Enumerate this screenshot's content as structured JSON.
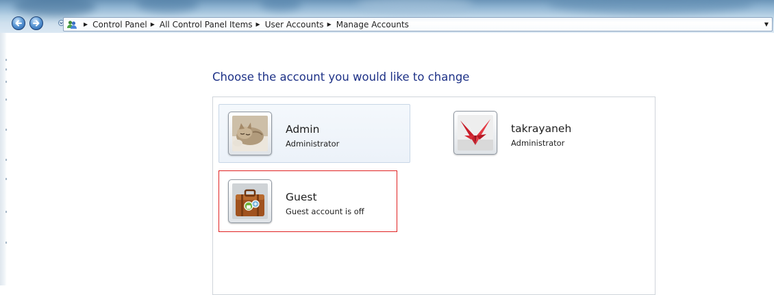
{
  "navigation": {
    "breadcrumbs": [
      "Control Panel",
      "All Control Panel Items",
      "User Accounts",
      "Manage Accounts"
    ],
    "icons": {
      "back": "back-arrow-icon",
      "forward": "forward-arrow-icon",
      "recent": "recent-pages-icon",
      "location": "user-accounts-icon",
      "dropdown": "chevron-down-icon"
    }
  },
  "main": {
    "title": "Choose the account you would like to change",
    "accounts": [
      {
        "name": "Admin",
        "type": "Administrator",
        "picture": "kitten-picture"
      },
      {
        "name": "takrayaneh",
        "type": "Administrator",
        "picture": "origami-crane-picture"
      },
      {
        "name": "Guest",
        "type": "Guest account is off",
        "picture": "suitcase-picture"
      }
    ]
  },
  "colors": {
    "title_text": "#1e3287",
    "selection_outline": "#e02020",
    "hover_background": "#ecf2f9",
    "aero_top": "#6b95b8"
  }
}
